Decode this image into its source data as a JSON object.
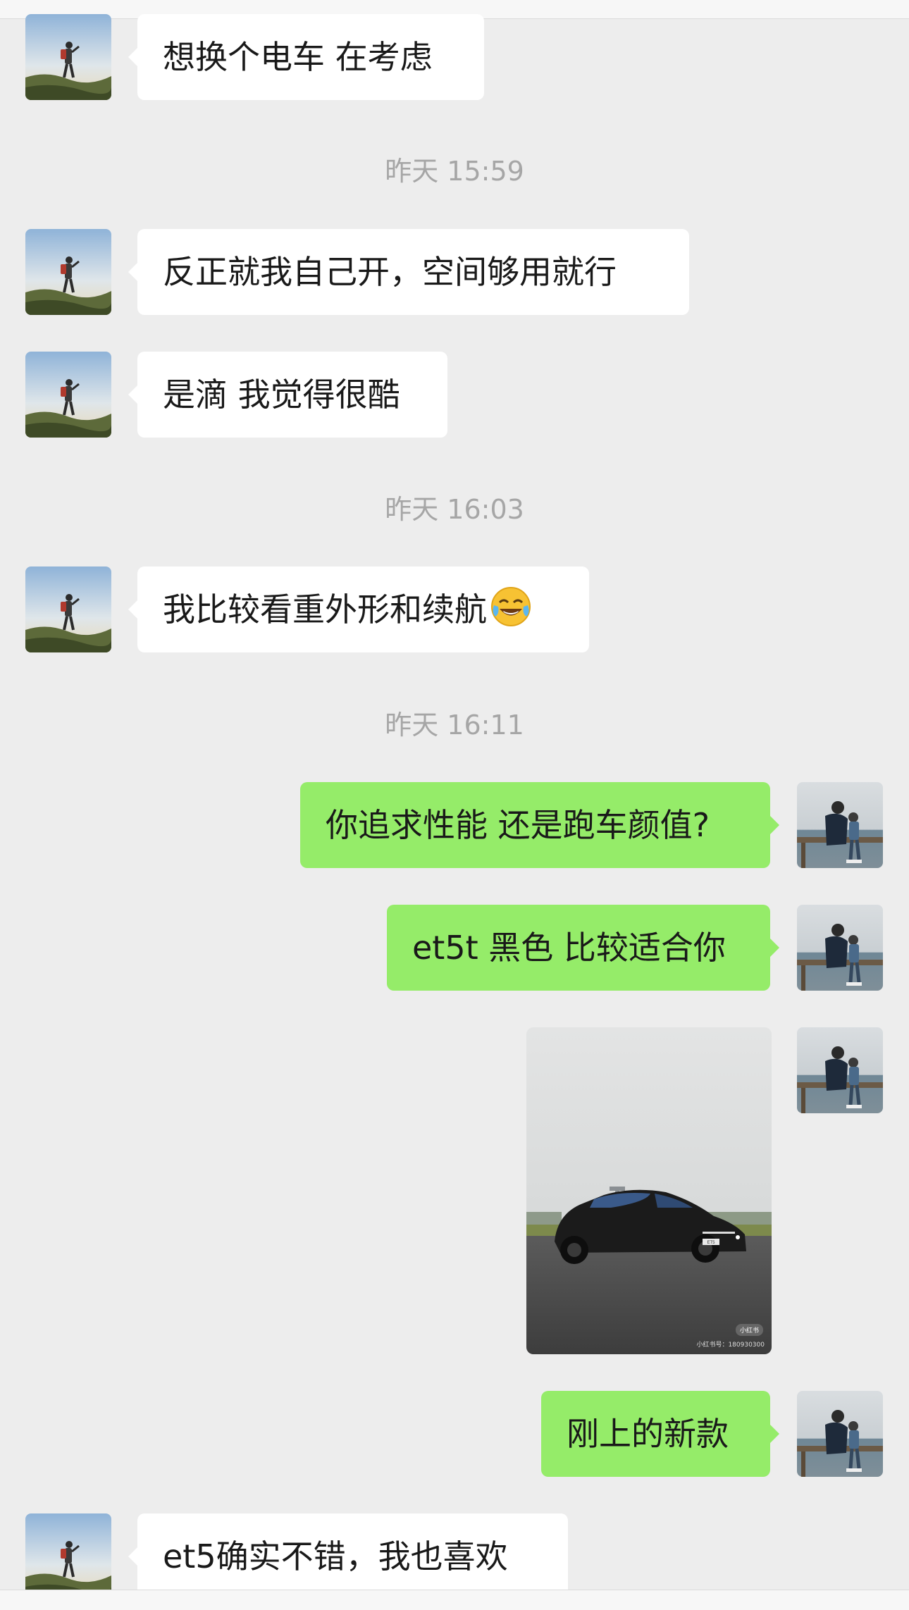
{
  "messages": {
    "m1": "想换个电车 在考虑",
    "m2": "反正就我自己开，空间够用就行",
    "m3": "是滴 我觉得很酷",
    "m4": "我比较看重外形和续航",
    "m5": "你追求性能 还是跑车颜值?",
    "m6": "et5t 黑色 比较适合你",
    "m8": "刚上的新款",
    "m9": "et5确实不错，我也喜欢"
  },
  "timestamps": {
    "t1": "昨天 15:59",
    "t2": "昨天 16:03",
    "t3": "昨天 16:11"
  },
  "emoji": "laughing-tears-emoji",
  "photo": {
    "badge": "小红书",
    "caption": "小红书号：180930300",
    "plate": "ET5"
  },
  "colors": {
    "background": "#ededed",
    "incoming_bubble": "#ffffff",
    "outgoing_bubble": "#95ec69",
    "timestamp": "#a6a6a6"
  }
}
